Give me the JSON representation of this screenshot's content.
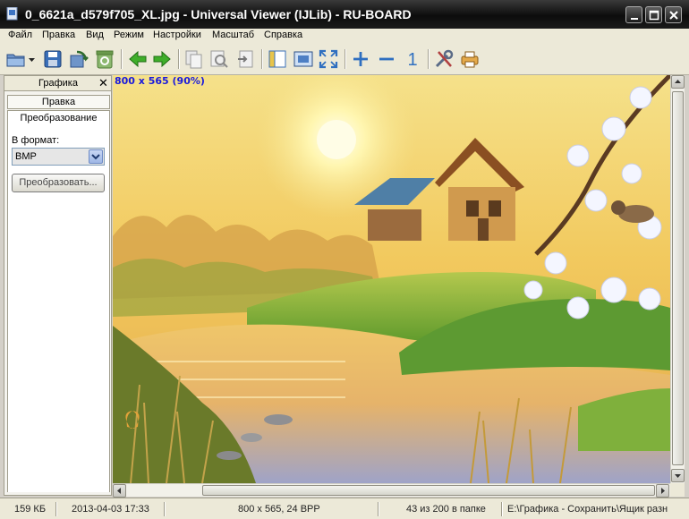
{
  "window": {
    "title": "0_6621a_d579f705_XL.jpg - Universal Viewer (IJLib) - RU-BOARD",
    "controls": [
      "minimize",
      "maximize",
      "close"
    ]
  },
  "menu": {
    "items": [
      "Файл",
      "Правка",
      "Вид",
      "Режим",
      "Настройки",
      "Масштаб",
      "Справка"
    ]
  },
  "toolbar": {
    "buttons": [
      {
        "icon": "open-folder-icon"
      },
      {
        "icon": "dropdown-arrow-icon"
      },
      {
        "icon": "save-icon"
      },
      {
        "icon": "export-icon"
      },
      {
        "icon": "recycle-icon"
      },
      {
        "icon": "arrow-left-icon"
      },
      {
        "icon": "arrow-right-icon"
      },
      {
        "icon": "copy-icon"
      },
      {
        "icon": "zoom-page-icon"
      },
      {
        "icon": "page-arrow-icon"
      },
      {
        "icon": "panel-icon"
      },
      {
        "icon": "fit-window-icon"
      },
      {
        "icon": "fullscreen-icon"
      },
      {
        "icon": "zoom-in-icon"
      },
      {
        "icon": "zoom-out-icon"
      },
      {
        "icon": "actual-size-icon"
      },
      {
        "icon": "tools-icon"
      },
      {
        "icon": "print-icon"
      }
    ],
    "actual_size_label": "1"
  },
  "side_panel": {
    "title": "Графика",
    "close_glyph": "✕",
    "tab_edit": "Правка",
    "tab_convert": "Преобразование",
    "format_label": "В формат:",
    "format_value": "BMP",
    "convert_button": "Преобразовать..."
  },
  "viewer": {
    "image_info": "800 x 565 (90%)"
  },
  "statusbar": {
    "file_size": "159 КБ",
    "date": "2013-04-03 17:33",
    "dimensions": "800 x 565, 24 BPP",
    "position": "43 из 200 в папке",
    "path": "E:\\Графика - Сохранить\\Ящик разн"
  },
  "colors": {
    "title_bar": "#111111",
    "menu_bg": "#ece9d8",
    "image_info_text": "#1a1adc"
  }
}
